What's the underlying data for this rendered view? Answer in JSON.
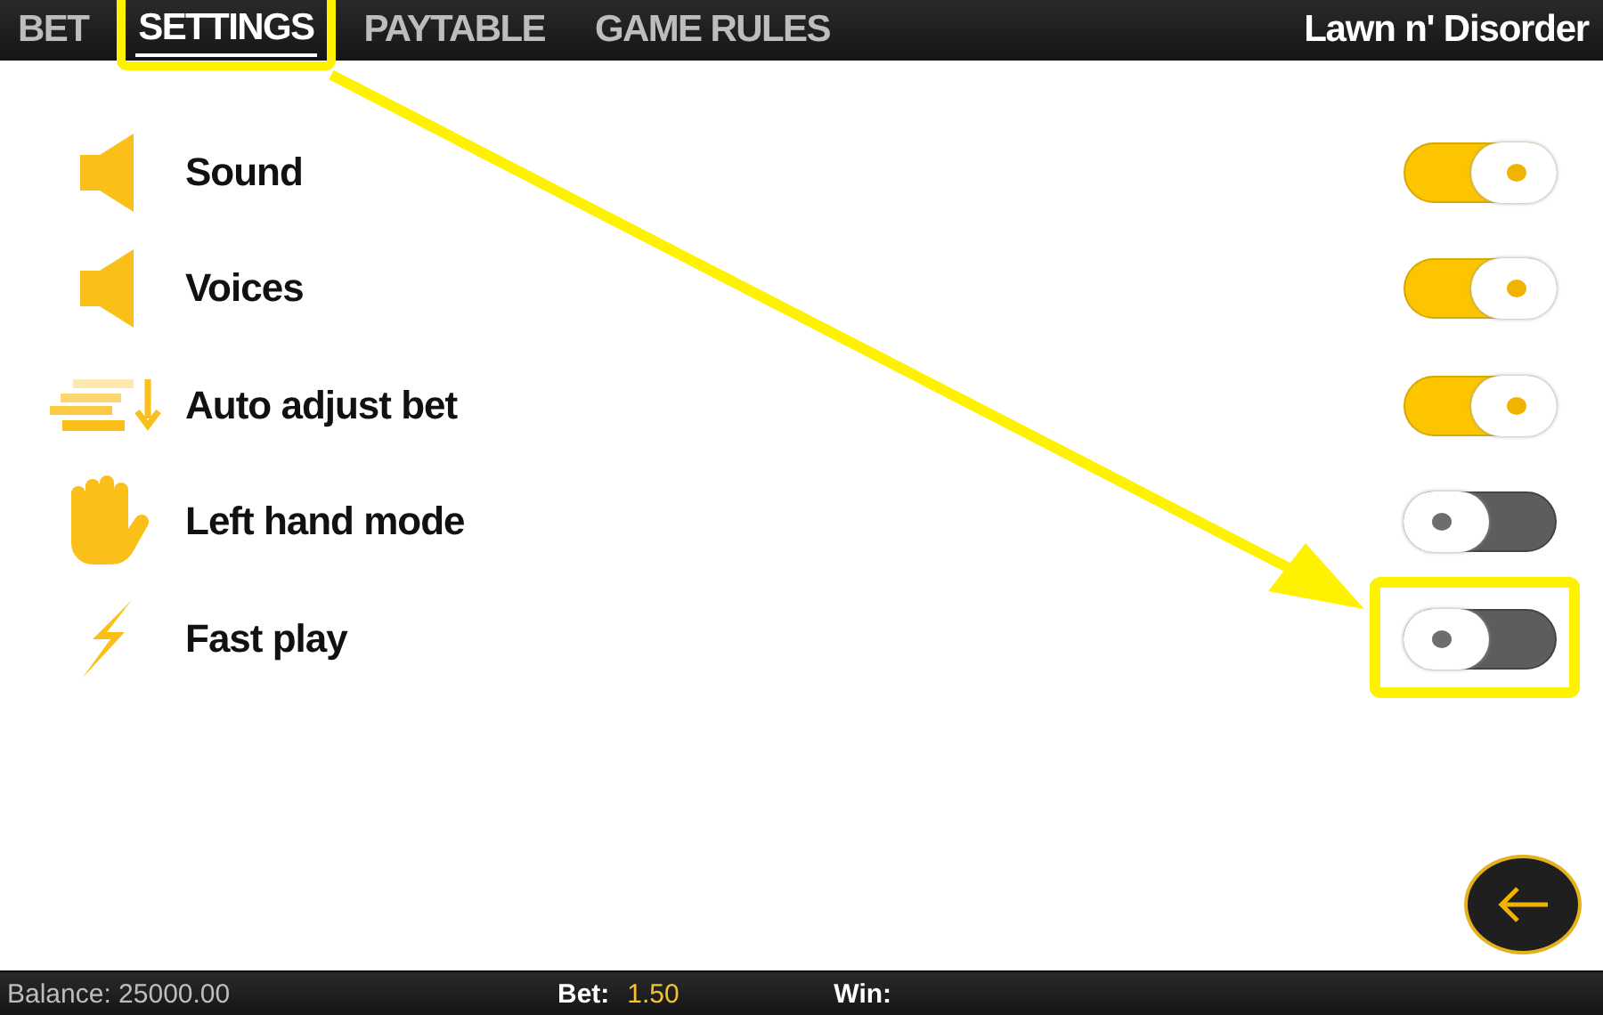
{
  "tabs": [
    {
      "label": "BET",
      "selected": false
    },
    {
      "label": "SETTINGS",
      "selected": true
    },
    {
      "label": "PAYTABLE",
      "selected": false
    },
    {
      "label": "GAME RULES",
      "selected": false
    }
  ],
  "game_title": "Lawn n' Disorder",
  "settings": [
    {
      "label": "Sound",
      "on": true
    },
    {
      "label": "Voices",
      "on": true
    },
    {
      "label": "Auto adjust bet",
      "on": true
    },
    {
      "label": "Left hand mode",
      "on": false
    },
    {
      "label": "Fast play",
      "on": false
    }
  ],
  "status_bar": {
    "balance_label": "Balance:",
    "balance": "25000.00",
    "bet_label": "Bet:",
    "bet": "1.50",
    "win_label": "Win:"
  }
}
